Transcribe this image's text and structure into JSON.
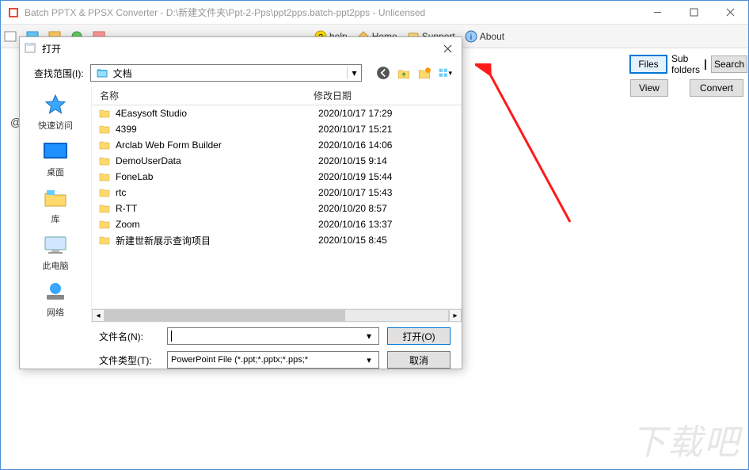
{
  "window": {
    "title": "Batch PPTX & PPSX Converter - D:\\新建文件夹\\Ppt-2-Pps\\ppt2pps.batch-ppt2pps - Unlicensed"
  },
  "toolbar": {
    "item_help": "help",
    "item_home": "Home",
    "item_support": "Support",
    "item_about": "About"
  },
  "panel": {
    "files_btn": "Files",
    "sub_folders": "Sub folders",
    "search_btn": "Search",
    "view_btn": "View",
    "convert_btn": "Convert"
  },
  "at_label": "@",
  "watermark": "下载吧",
  "dialog": {
    "title": "打开",
    "lookup_label": "查找范围(I):",
    "lookup_value": "文档",
    "columns": {
      "name": "名称",
      "date": "修改日期"
    },
    "places": {
      "quick": "快速访问",
      "desktop": "桌面",
      "libraries": "库",
      "thispc": "此电脑",
      "network": "网络"
    },
    "files": [
      {
        "name": "4Easysoft Studio",
        "date": "2020/10/17 17:29"
      },
      {
        "name": "4399",
        "date": "2020/10/17 15:21"
      },
      {
        "name": "Arclab Web Form Builder",
        "date": "2020/10/16 14:06"
      },
      {
        "name": "DemoUserData",
        "date": "2020/10/15 9:14"
      },
      {
        "name": "FoneLab",
        "date": "2020/10/19 15:44"
      },
      {
        "name": "rtc",
        "date": "2020/10/17 15:43"
      },
      {
        "name": "R-TT",
        "date": "2020/10/20 8:57"
      },
      {
        "name": "Zoom",
        "date": "2020/10/16 13:37"
      },
      {
        "name": "新建世新展示查询项目",
        "date": "2020/10/15 8:45"
      }
    ],
    "filename_label": "文件名(N):",
    "filename_value": "",
    "filetype_label": "文件类型(T):",
    "filetype_value": "PowerPoint File (*.ppt;*.pptx;*.pps;*",
    "open_btn": "打开(O)",
    "cancel_btn": "取消"
  }
}
